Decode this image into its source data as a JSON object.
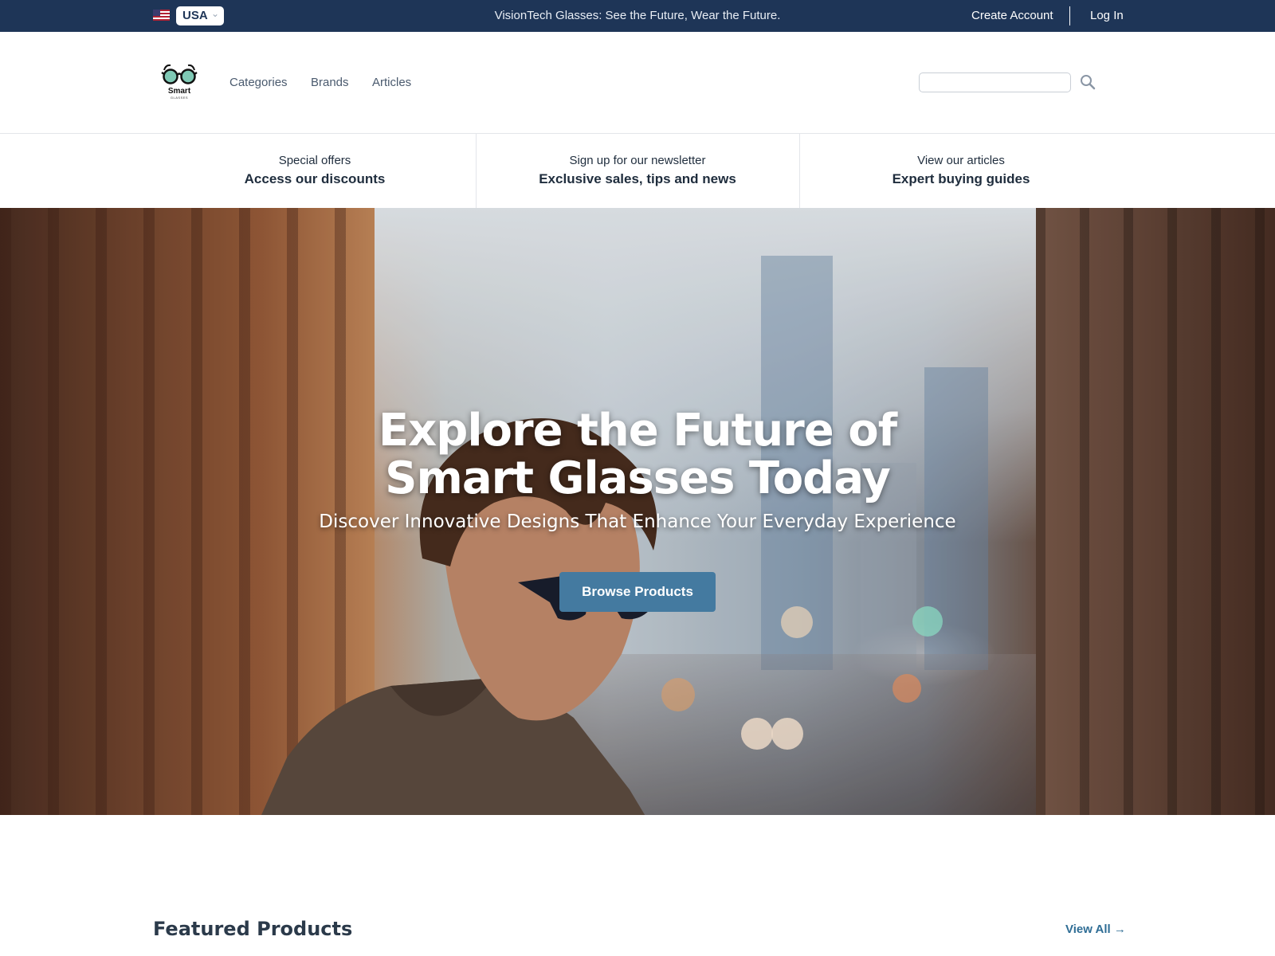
{
  "topbar": {
    "country": "USA",
    "tagline": "VisionTech Glasses: See the Future, Wear the Future.",
    "create_account": "Create Account",
    "log_in": "Log In"
  },
  "header": {
    "logo_text": "Smart",
    "logo_subtext": "GLASSES",
    "nav": [
      "Categories",
      "Brands",
      "Articles"
    ],
    "search_placeholder": ""
  },
  "promos": [
    {
      "small": "Special offers",
      "big": "Access our discounts"
    },
    {
      "small": "Sign up for our newsletter",
      "big": "Exclusive sales, tips and news"
    },
    {
      "small": "View our articles",
      "big": "Expert buying guides"
    }
  ],
  "hero": {
    "title": "Explore the Future of Smart Glasses Today",
    "subtitle": "Discover Innovative Designs That Enhance Your Everyday Experience",
    "button": "Browse Products"
  },
  "featured": {
    "title": "Featured Products",
    "view_all": "View All →"
  },
  "colors": {
    "topbar_bg": "#1e3557",
    "button_bg": "#447aa0",
    "link": "#2f6d95"
  }
}
